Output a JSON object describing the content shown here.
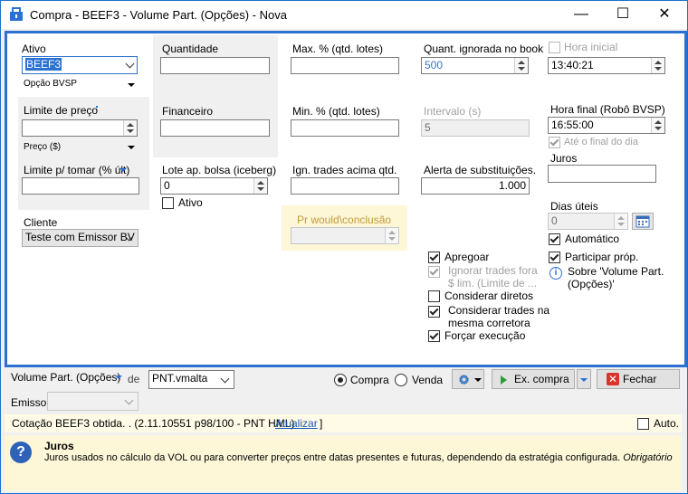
{
  "window": {
    "title": "Compra - BEEF3 - Volume Part. (Opções) - Nova",
    "minimize": "—",
    "maximize": "☐",
    "close": "✕"
  },
  "ativo": {
    "label": "Ativo",
    "value": "BEEF3",
    "tipo": "Opção BVSP"
  },
  "limite_preco": {
    "label": "Limite de preço",
    "value": "",
    "tipo": "Preço ($)"
  },
  "limite_tomar": {
    "label": "Limite p/ tomar (% últ)",
    "value": ""
  },
  "cliente": {
    "label": "Cliente",
    "value": "Teste com Emissor BV"
  },
  "quantidade": {
    "label": "Quantidade",
    "value": ""
  },
  "financeiro": {
    "label": "Financeiro",
    "value": ""
  },
  "lote": {
    "label": "Lote ap. bolsa (iceberg)",
    "value": "0",
    "ativo_label": "Ativo"
  },
  "max_pct": {
    "label": "Max. % (qtd. lotes)",
    "value": ""
  },
  "min_pct": {
    "label": "Min. % (qtd. lotes)",
    "value": ""
  },
  "ign_trades": {
    "label": "Ign. trades acima qtd.",
    "value": ""
  },
  "pr_would": {
    "label": "Pr would\\conclusão",
    "value": ""
  },
  "quant_ignorada": {
    "label": "Quant. ignorada no book",
    "value": "500"
  },
  "intervalo": {
    "label": "Intervalo (s)",
    "value": "5"
  },
  "alerta": {
    "label": "Alerta de substituições.",
    "value": "1.000"
  },
  "checks": {
    "apregoar": "Apregoar",
    "ignorar_line1": "Ignorar trades fora",
    "ignorar_line2": "$ lim. (Limite de ...",
    "considerar_diretos": "Considerar diretos",
    "considerar_mesma_line1": "Considerar trades na",
    "considerar_mesma_line2": "mesma corretora",
    "forcar": "Forçar execução"
  },
  "hora_inicial": {
    "label": "Hora inicial",
    "value": "13:40:21"
  },
  "hora_final": {
    "label": "Hora final (Robô BVSP)",
    "value": "16:55:00",
    "ate_final": "Até o final do dia"
  },
  "juros": {
    "label": "Juros",
    "value": ""
  },
  "dias_uteis": {
    "label": "Dias úteis",
    "value": "0",
    "automatico": "Automático"
  },
  "participar": "Participar próp.",
  "sobre_line1": "Sobre 'Volume Part.",
  "sobre_line2": "(Opções)'",
  "bottom": {
    "estrategia": "Volume Part. (Opções)",
    "de": "de",
    "fonte": "PNT.vmalta",
    "compra": "Compra",
    "venda": "Venda",
    "ex_compra": "Ex. compra",
    "fechar": "Fechar",
    "emissor": "Emissor",
    "emissor_value": ""
  },
  "status": {
    "text": "Cotação BEEF3 obtida. .  (2.11.10551 p98/100 - PNT HML)",
    "link": "Atualizar",
    "auto": "Auto."
  },
  "help": {
    "title": "Juros",
    "body": "Juros usados no cálculo da VOL ou para converter preços entre datas presentes e futuras, dependendo da estratégia configurada.",
    "obrigatorio": "Obrigatório"
  },
  "colors": {
    "accent": "#2b71d1",
    "help_bg": "#fdf7d8",
    "status_bg": "#fffbe6"
  }
}
